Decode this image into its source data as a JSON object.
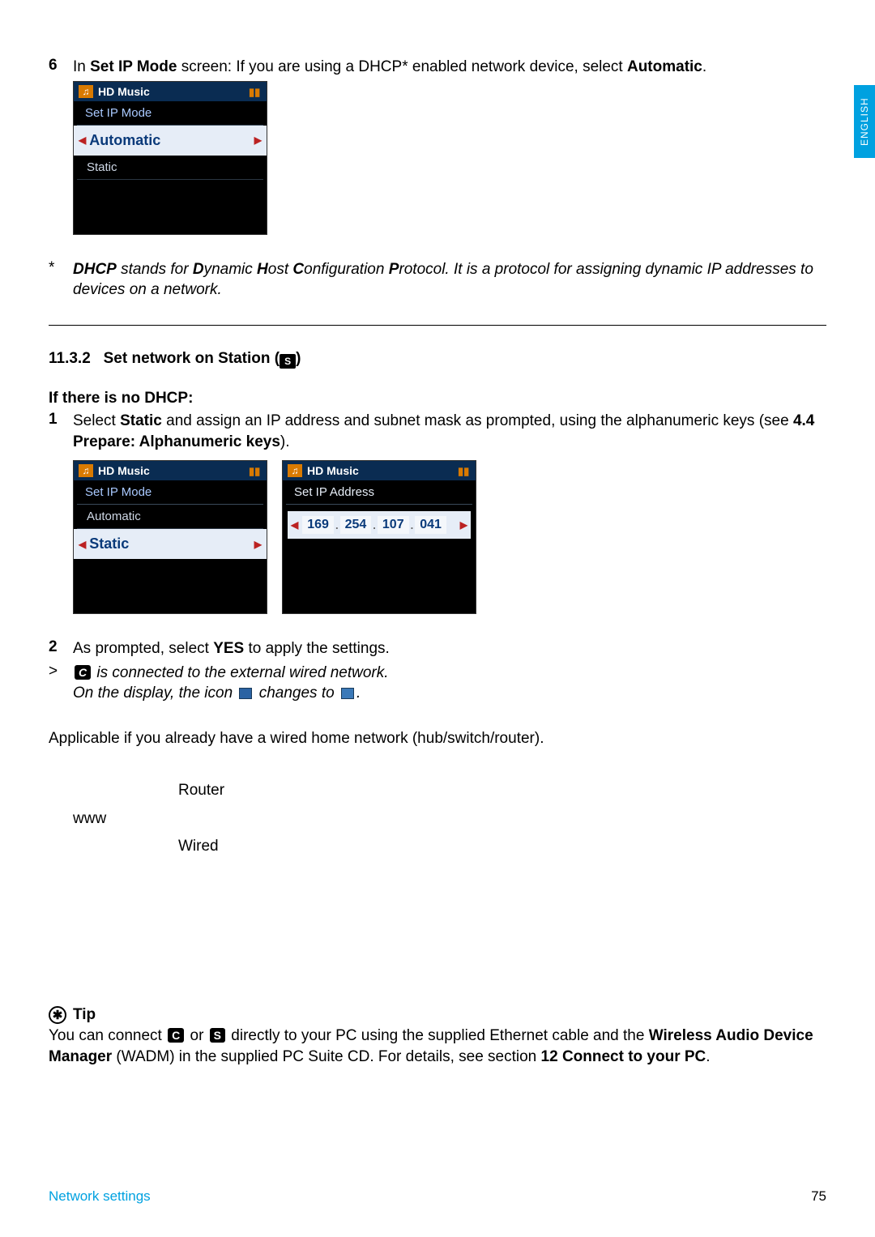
{
  "langTab": "ENGLISH",
  "step6": {
    "num": "6",
    "prefix": "In ",
    "screenName": "Set IP Mode",
    "mid": " screen: If you are using a DHCP* enabled network device, select ",
    "action": "Automatic",
    "suffix": "."
  },
  "screenA": {
    "header": "HD Music",
    "menuTitle": "Set IP Mode",
    "selected": "Automatic",
    "item2": "Static"
  },
  "footnote": {
    "mark": "*",
    "lead": "DHCP",
    "mid1": " stands for ",
    "d": "D",
    "dr": "ynamic ",
    "h": "H",
    "hr": "ost ",
    "c": "C",
    "cr": "onfiguration ",
    "p": "P",
    "pr": "rotocol. It is a protocol for assigning dynamic IP addresses to devices on a network."
  },
  "section": {
    "num": "11.3.2",
    "title": "Set network on Station (",
    "badge": "S",
    "close": ")"
  },
  "noDhcp": {
    "heading": "If there is no DHCP:",
    "step1num": "1",
    "s1a": "Select ",
    "s1b": "Static",
    "s1c": " and assign an IP address and subnet mask as prompted, using the alphanumeric keys (see ",
    "s1d": "4.4 Prepare: Alphanumeric keys",
    "s1e": ")."
  },
  "screenB": {
    "header": "HD Music",
    "menuTitle": "Set IP Mode",
    "item1": "Automatic",
    "selected": "Static"
  },
  "screenC": {
    "header": "HD Music",
    "menuTitle": "Set IP Address",
    "ip": [
      "169",
      "254",
      "107",
      "041"
    ]
  },
  "step2": {
    "num": "2",
    "a": "As prompted, select ",
    "b": "YES",
    "c": " to apply the settings."
  },
  "result": {
    "mark": ">",
    "badge": "C",
    "line1": " is connected to the external wired network.",
    "line2a": "On the display, the icon ",
    "line2b": " changes to ",
    "line2c": "."
  },
  "applicable": "Applicable if you already have a wired home network (hub/switch/router).",
  "net": {
    "www": "www",
    "router": "Router",
    "wired": "Wired"
  },
  "tip": {
    "label": "Tip",
    "t1": "You can connect ",
    "badgeC": "C",
    "t2": " or ",
    "badgeS": "S",
    "t3": " directly to your PC using the supplied Ethernet cable and the ",
    "wadm": "Wireless Audio Device Manager",
    "t4": " (WADM) in the supplied PC Suite CD. For details, see section ",
    "sec": "12 Connect to your PC",
    "t5": "."
  },
  "footer": {
    "left": "Network settings",
    "right": "75"
  }
}
